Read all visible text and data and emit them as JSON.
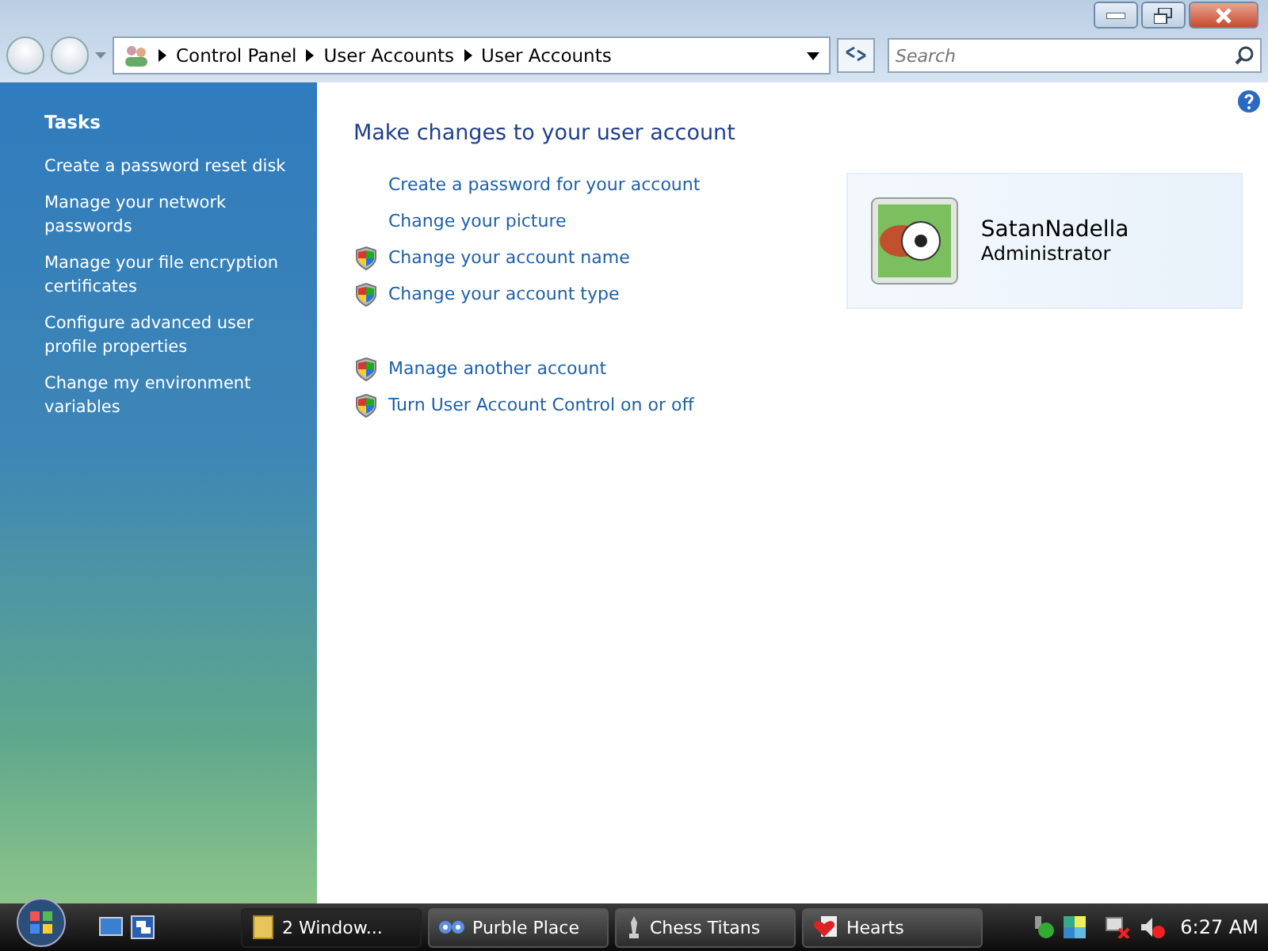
{
  "breadcrumb": [
    "Control Panel",
    "User Accounts",
    "User Accounts"
  ],
  "search": {
    "placeholder": "Search"
  },
  "sidebar": {
    "title": "Tasks",
    "items": [
      "Create a password reset disk",
      "Manage your network passwords",
      "Manage your file encryption certificates",
      "Configure advanced user profile properties",
      "Change my environment variables"
    ]
  },
  "main": {
    "heading": "Make changes to your user account",
    "link_groups": [
      [
        {
          "label": "Create a password for your account",
          "shield": false
        },
        {
          "label": "Change your picture",
          "shield": false
        },
        {
          "label": "Change your account name",
          "shield": true
        },
        {
          "label": "Change your account type",
          "shield": true
        }
      ],
      [
        {
          "label": "Manage another account",
          "shield": true
        },
        {
          "label": "Turn User Account Control on or off",
          "shield": true
        }
      ]
    ]
  },
  "account": {
    "name": "SatanNadella",
    "role": "Administrator"
  },
  "taskbar": {
    "buttons": [
      {
        "label": "2 Window...",
        "selected": true,
        "kind": "folder"
      },
      {
        "label": "Purble Place",
        "selected": false,
        "kind": "eyes"
      },
      {
        "label": "Chess Titans",
        "selected": false,
        "kind": "chess"
      },
      {
        "label": "Hearts",
        "selected": false,
        "kind": "hearts"
      }
    ],
    "clock": "6:27 AM"
  }
}
